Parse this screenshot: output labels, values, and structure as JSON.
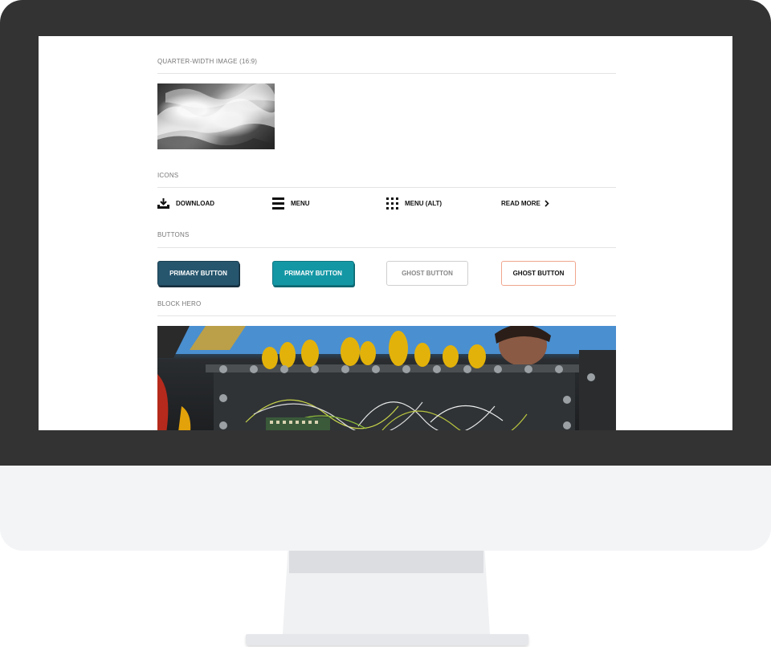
{
  "sections": {
    "image_heading": "QUARTER-WIDTH IMAGE (16:9)",
    "icons_heading": "ICONS",
    "buttons_heading": "BUTTONS",
    "hero_heading": "BLOCK HERO"
  },
  "icons": [
    {
      "label": "DOWNLOAD",
      "icon": "download-icon"
    },
    {
      "label": "MENU",
      "icon": "menu-icon"
    },
    {
      "label": "MENU (ALT)",
      "icon": "grid-menu-icon"
    },
    {
      "label": "READ MORE",
      "icon": "chevron-right-icon"
    }
  ],
  "buttons": {
    "primary_dark": "PRIMARY BUTTON",
    "primary_teal": "PRIMARY BUTTON",
    "ghost_grey": "GHOST BUTTON",
    "ghost_orange": "GHOST BUTTON"
  },
  "colors": {
    "primary_dark": "#26566e",
    "primary_teal": "#1497a5",
    "ghost_orange_border": "#f0a58e",
    "bezel": "#333333"
  }
}
